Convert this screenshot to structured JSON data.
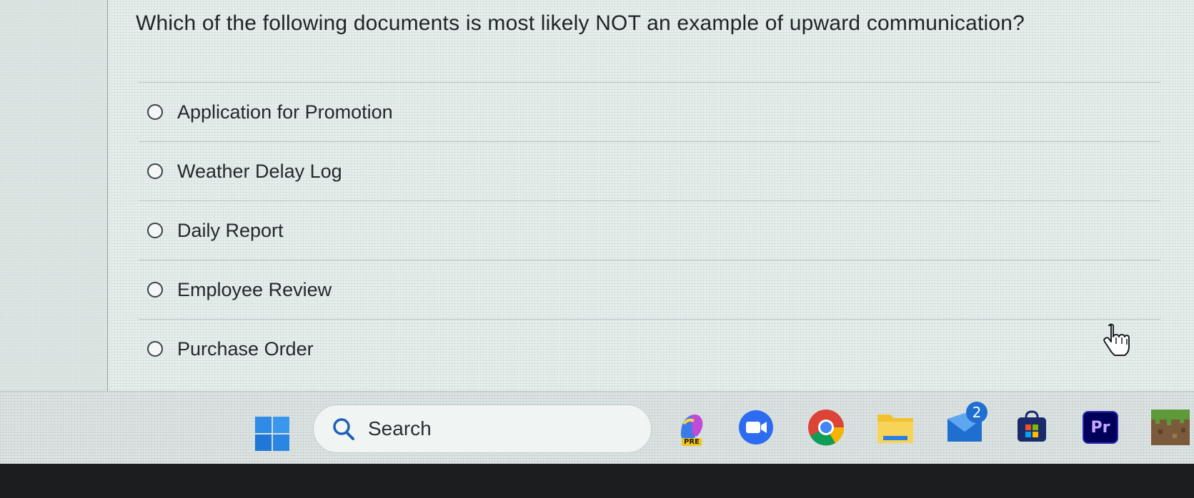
{
  "question": {
    "text": "Which of the following documents is most likely NOT an example of upward communication?"
  },
  "options": [
    {
      "label": "Application for Promotion",
      "selected": false
    },
    {
      "label": "Weather Delay Log",
      "selected": false
    },
    {
      "label": "Daily Report",
      "selected": false
    },
    {
      "label": "Employee Review",
      "selected": false
    },
    {
      "label": "Purchase Order",
      "selected": false
    }
  ],
  "taskbar": {
    "search_label": "Search",
    "apps": [
      {
        "name": "copilot-pre-icon",
        "label": "PRE"
      },
      {
        "name": "zoom-icon"
      },
      {
        "name": "chrome-icon"
      },
      {
        "name": "file-explorer-icon"
      },
      {
        "name": "mail-icon",
        "badge": "2"
      },
      {
        "name": "microsoft-store-icon"
      },
      {
        "name": "premiere-pro-icon",
        "label": "Pr"
      },
      {
        "name": "minecraft-icon"
      }
    ]
  },
  "colors": {
    "screen_background": "#e8eeec",
    "text": "#1f2326",
    "accent_blue": "#1f6fd1",
    "premiere_bg": "#00005b"
  }
}
